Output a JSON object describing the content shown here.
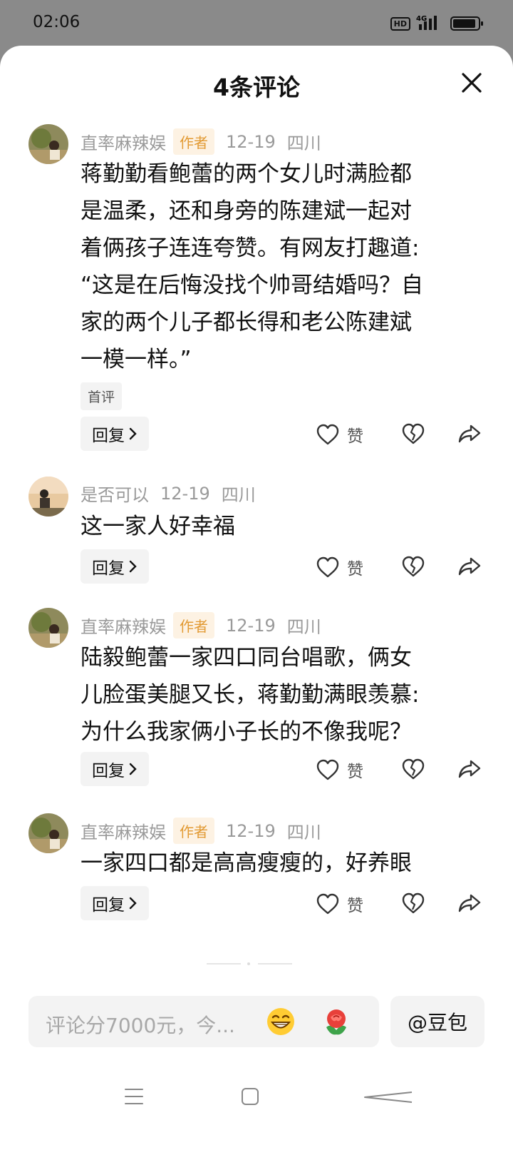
{
  "status_bar": {
    "time": "02:06",
    "hd": "HD",
    "network": "4G",
    "battery_level": 0.9
  },
  "sheet": {
    "title": "4条评论"
  },
  "comments": [
    {
      "author": "直率麻辣娱",
      "badge": "作者",
      "date": "12-19",
      "location": "四川",
      "text_lines": [
        "蒋勤勤看鲍蕾的两个女儿时满脸都",
        "是温柔，还和身旁的陈建斌一起对",
        "着俩孩子连连夸赞。有网友打趣道:",
        "“这是在后悔没找个帅哥结婚吗？自",
        "家的两个儿子都长得和老公陈建斌",
        "一模一样。”"
      ],
      "tag": "首评",
      "reply_label": "回复",
      "like_label": "赞"
    },
    {
      "author": "是否可以",
      "date": "12-19",
      "location": "四川",
      "text_lines": [
        "这一家人好幸福"
      ],
      "reply_label": "回复",
      "like_label": "赞"
    },
    {
      "author": "直率麻辣娱",
      "badge": "作者",
      "date": "12-19",
      "location": "四川",
      "text_lines": [
        "陆毅鲍蕾一家四口同台唱歌，俩女",
        "儿脸蛋美腿又长，蒋勤勤满眼羡慕:",
        "为什么我家俩小子长的不像我呢？"
      ],
      "reply_label": "回复",
      "like_label": "赞"
    },
    {
      "author": "直率麻辣娱",
      "badge": "作者",
      "date": "12-19",
      "location": "四川",
      "text_lines": [
        "一家四口都是高高瘦瘦的，好养眼"
      ],
      "reply_label": "回复",
      "like_label": "赞"
    }
  ],
  "input": {
    "placeholder": "评论分7000元，今..."
  },
  "at_button": "@豆包",
  "icons": {
    "close": "close-icon",
    "like": "heart-icon",
    "dislike": "broken-heart-icon",
    "share": "share-arrow-icon",
    "emoji_grin": "grinning-emoji-icon",
    "emoji_rose": "rose-emoji-icon"
  },
  "colors": {
    "badge_bg": "#fdf2e3",
    "badge_text": "#e29a33",
    "meta_text": "#9a9a9a"
  }
}
